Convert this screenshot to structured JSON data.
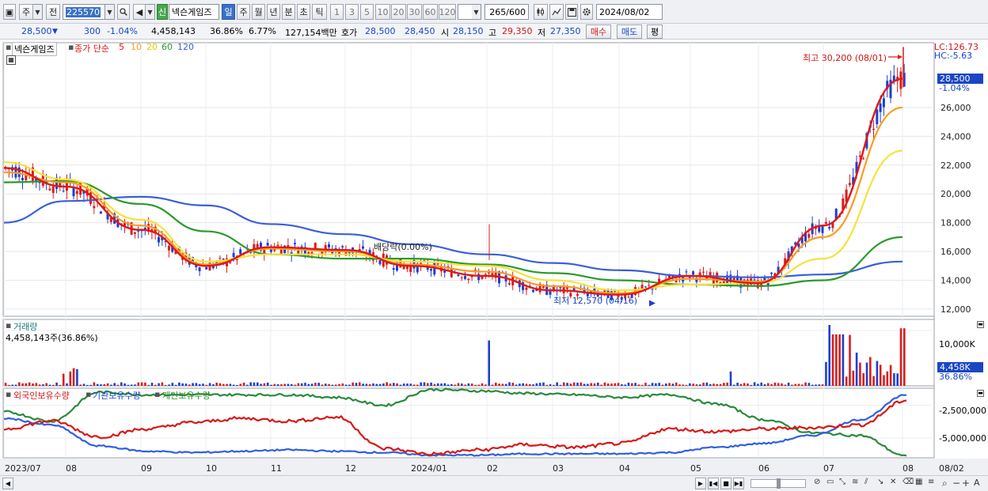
{
  "toolbar": {
    "market_type": "주",
    "prev_label": "전",
    "code": "225570",
    "new_badge": "신",
    "stock_name": "넥슨게임즈",
    "periods": [
      "일",
      "주",
      "월",
      "년",
      "분",
      "초",
      "틱"
    ],
    "selected_period": "일",
    "intervals": [
      "1",
      "3",
      "5",
      "10",
      "20",
      "30",
      "60",
      "120"
    ],
    "count": "265",
    "count_max": "/600",
    "date": "2024/08/02"
  },
  "quote": {
    "price": "28,500",
    "change": "300",
    "change_pct": "-1.04%",
    "volume": "4,458,143",
    "turnover_pct": "36.86%",
    "pct2": "6.77%",
    "amount": "127,154백만",
    "ask_label": "호가",
    "ask": "28,500",
    "bid": "28,450",
    "open_label": "시",
    "open": "28,150",
    "high_label": "고",
    "high": "29,350",
    "low_label": "저",
    "low": "27,350",
    "buy_label": "매수",
    "sell_label": "매도",
    "eval_label": "평"
  },
  "price_pane": {
    "stock_tag": "넥슨게임즈",
    "ma_label": "종가 단순",
    "ma_periods": [
      "5",
      "10",
      "20",
      "60",
      "120"
    ],
    "lc": "LC:126.73",
    "hc": "HC:-5.63",
    "high_note": "최고 30,200 (08/01)",
    "low_note": "최저 12,570 (04/16)",
    "dividend_note": "배당락(0.00%)",
    "current_price_tag": "28,500",
    "current_pct_tag": "-1.04%",
    "y_ticks": [
      "26,000",
      "24,000",
      "22,000",
      "20,000",
      "18,000",
      "16,000",
      "14,000",
      "12,000"
    ]
  },
  "volume_pane": {
    "title": "거래량",
    "value": "4,458,143주(36.86%)",
    "y_tick": "10,000K",
    "tag_value": "4,458K",
    "tag_pct": "36.86%"
  },
  "holdings_pane": {
    "series_labels": [
      "외국인보유수량",
      "기관보유수량",
      "개인보유수량"
    ],
    "y_ticks": [
      "-2,500,000",
      "-5,000,000"
    ]
  },
  "x_axis": {
    "labels": [
      "2023/07",
      "08",
      "09",
      "10",
      "11",
      "12",
      "2024/01",
      "02",
      "03",
      "04",
      "05",
      "06",
      "07",
      "08",
      "08/02"
    ]
  },
  "colors": {
    "ma5": "#e01818",
    "ma10": "#ff9a1e",
    "ma20": "#f6e23a",
    "ma60": "#2a9a2a",
    "ma120": "#3a5fd8",
    "up": "#d81e1e",
    "down": "#1e3fd0"
  },
  "chart_data": {
    "type": "line",
    "title": "",
    "x": [
      "2023/07",
      "08",
      "09",
      "10",
      "11",
      "12",
      "2024/01",
      "02",
      "03",
      "04",
      "05",
      "06",
      "07",
      "08"
    ],
    "ylim": [
      11500,
      30500
    ],
    "series": [
      {
        "name": "5",
        "values": [
          21800,
          20500,
          17500,
          15000,
          16300,
          16100,
          15000,
          14300,
          13300,
          13000,
          14300,
          13800,
          17800,
          28000
        ]
      },
      {
        "name": "10",
        "values": [
          21500,
          20800,
          17800,
          15100,
          16200,
          16000,
          15100,
          14600,
          13600,
          13100,
          14100,
          13900,
          17000,
          26000
        ]
      },
      {
        "name": "20",
        "values": [
          22200,
          21000,
          18200,
          15300,
          15800,
          15800,
          15300,
          15000,
          14000,
          13300,
          13700,
          13800,
          15500,
          23000
        ]
      },
      {
        "name": "60",
        "values": [
          20800,
          20900,
          19300,
          17400,
          15800,
          15500,
          15500,
          15100,
          14500,
          14000,
          13700,
          13600,
          14000,
          17000
        ]
      },
      {
        "name": "120",
        "values": [
          18000,
          19500,
          19800,
          19200,
          17900,
          17200,
          16500,
          15800,
          15200,
          14700,
          14300,
          14200,
          14400,
          15300
        ]
      }
    ],
    "high": {
      "value": 30200,
      "date": "08/01"
    },
    "low": {
      "value": 12570,
      "date": "04/16"
    }
  }
}
